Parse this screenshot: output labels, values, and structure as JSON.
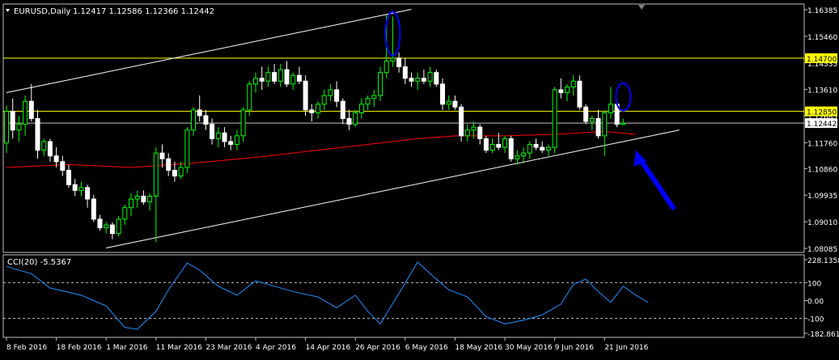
{
  "header": {
    "symbol": "EURUSD,Daily",
    "ohlc": "1.12417 1.12586 1.12366 1.12442"
  },
  "indicator": {
    "title": "CCI(20) -5.5367",
    "levels": [
      100,
      -100
    ],
    "y_ticks": [
      "228.1358",
      "100",
      "0.00",
      "-100",
      "-182.8614"
    ],
    "ylim": [
      -182.8614,
      228.1358
    ]
  },
  "colors": {
    "background": "#000000",
    "grid_border": "#c0c0c0",
    "bull_candle": "#00ff00",
    "bear_candle": "#ffffff",
    "ma_line": "#ff0000",
    "horizontal_level": "#ffff00",
    "channel_line": "#ffffff",
    "cci_line": "#1e90ff",
    "annotation": "#0000ff"
  },
  "chart_data": [
    {
      "type": "candlestick",
      "symbol": "EURUSD",
      "timeframe": "Daily",
      "ylim": [
        1.08085,
        1.16385
      ],
      "y_ticks": [
        "1.16385",
        "1.15460",
        "1.14535",
        "1.13610",
        "1.12685",
        "1.11760",
        "1.10860",
        "1.09935",
        "1.09010",
        "1.08085"
      ],
      "x_ticks": [
        "8 Feb 2016",
        "18 Feb 2016",
        "1 Mar 2016",
        "11 Mar 2016",
        "23 Mar 2016",
        "4 Apr 2016",
        "14 Apr 2016",
        "26 Apr 2016",
        "6 May 2016",
        "18 May 2016",
        "30 May 2016",
        "9 Jun 2016",
        "21 Jun 2016"
      ],
      "x_tick_index": [
        0,
        8,
        16,
        24,
        32,
        40,
        48,
        56,
        64,
        72,
        80,
        88,
        96
      ],
      "price_labels": [
        {
          "value": 1.147,
          "label": "1.14700",
          "style": "yellow-line"
        },
        {
          "value": 1.1285,
          "label": "1.12850",
          "style": "yellow-line"
        },
        {
          "value": 1.12442,
          "label": "1.12442",
          "style": "current-price"
        }
      ],
      "candles": [
        {
          "o": 1.1175,
          "h": 1.1305,
          "l": 1.114,
          "c": 1.1285
        },
        {
          "o": 1.1285,
          "h": 1.133,
          "l": 1.119,
          "c": 1.122
        },
        {
          "o": 1.122,
          "h": 1.127,
          "l": 1.118,
          "c": 1.124
        },
        {
          "o": 1.124,
          "h": 1.134,
          "l": 1.12,
          "c": 1.132
        },
        {
          "o": 1.132,
          "h": 1.138,
          "l": 1.125,
          "c": 1.126
        },
        {
          "o": 1.126,
          "h": 1.129,
          "l": 1.112,
          "c": 1.115
        },
        {
          "o": 1.115,
          "h": 1.119,
          "l": 1.113,
          "c": 1.118
        },
        {
          "o": 1.118,
          "h": 1.119,
          "l": 1.111,
          "c": 1.113
        },
        {
          "o": 1.113,
          "h": 1.116,
          "l": 1.109,
          "c": 1.111
        },
        {
          "o": 1.111,
          "h": 1.113,
          "l": 1.106,
          "c": 1.108
        },
        {
          "o": 1.108,
          "h": 1.11,
          "l": 1.102,
          "c": 1.103
        },
        {
          "o": 1.103,
          "h": 1.105,
          "l": 1.099,
          "c": 1.101
        },
        {
          "o": 1.101,
          "h": 1.104,
          "l": 1.099,
          "c": 1.102
        },
        {
          "o": 1.102,
          "h": 1.103,
          "l": 1.095,
          "c": 1.098
        },
        {
          "o": 1.098,
          "h": 1.0995,
          "l": 1.09,
          "c": 1.091
        },
        {
          "o": 1.091,
          "h": 1.0925,
          "l": 1.087,
          "c": 1.088
        },
        {
          "o": 1.088,
          "h": 1.09,
          "l": 1.086,
          "c": 1.089
        },
        {
          "o": 1.089,
          "h": 1.09,
          "l": 1.084,
          "c": 1.086
        },
        {
          "o": 1.086,
          "h": 1.092,
          "l": 1.085,
          "c": 1.091
        },
        {
          "o": 1.091,
          "h": 1.096,
          "l": 1.089,
          "c": 1.095
        },
        {
          "o": 1.095,
          "h": 1.1,
          "l": 1.092,
          "c": 1.098
        },
        {
          "o": 1.098,
          "h": 1.101,
          "l": 1.095,
          "c": 1.099
        },
        {
          "o": 1.099,
          "h": 1.101,
          "l": 1.096,
          "c": 1.097
        },
        {
          "o": 1.097,
          "h": 1.1,
          "l": 1.094,
          "c": 1.099
        },
        {
          "o": 1.099,
          "h": 1.116,
          "l": 1.083,
          "c": 1.114
        },
        {
          "o": 1.114,
          "h": 1.117,
          "l": 1.109,
          "c": 1.112
        },
        {
          "o": 1.112,
          "h": 1.114,
          "l": 1.106,
          "c": 1.108
        },
        {
          "o": 1.108,
          "h": 1.111,
          "l": 1.104,
          "c": 1.106
        },
        {
          "o": 1.106,
          "h": 1.111,
          "l": 1.105,
          "c": 1.109
        },
        {
          "o": 1.109,
          "h": 1.123,
          "l": 1.107,
          "c": 1.122
        },
        {
          "o": 1.122,
          "h": 1.13,
          "l": 1.12,
          "c": 1.129
        },
        {
          "o": 1.129,
          "h": 1.134,
          "l": 1.125,
          "c": 1.127
        },
        {
          "o": 1.127,
          "h": 1.129,
          "l": 1.122,
          "c": 1.124
        },
        {
          "o": 1.124,
          "h": 1.126,
          "l": 1.117,
          "c": 1.119
        },
        {
          "o": 1.119,
          "h": 1.123,
          "l": 1.116,
          "c": 1.121
        },
        {
          "o": 1.121,
          "h": 1.123,
          "l": 1.116,
          "c": 1.118
        },
        {
          "o": 1.118,
          "h": 1.12,
          "l": 1.115,
          "c": 1.117
        },
        {
          "o": 1.117,
          "h": 1.122,
          "l": 1.115,
          "c": 1.12
        },
        {
          "o": 1.12,
          "h": 1.13,
          "l": 1.118,
          "c": 1.129
        },
        {
          "o": 1.129,
          "h": 1.139,
          "l": 1.127,
          "c": 1.138
        },
        {
          "o": 1.138,
          "h": 1.142,
          "l": 1.135,
          "c": 1.14
        },
        {
          "o": 1.14,
          "h": 1.144,
          "l": 1.136,
          "c": 1.139
        },
        {
          "o": 1.139,
          "h": 1.144,
          "l": 1.137,
          "c": 1.142
        },
        {
          "o": 1.142,
          "h": 1.145,
          "l": 1.138,
          "c": 1.139
        },
        {
          "o": 1.139,
          "h": 1.145,
          "l": 1.137,
          "c": 1.143
        },
        {
          "o": 1.143,
          "h": 1.146,
          "l": 1.137,
          "c": 1.138
        },
        {
          "o": 1.138,
          "h": 1.142,
          "l": 1.136,
          "c": 1.141
        },
        {
          "o": 1.141,
          "h": 1.144,
          "l": 1.138,
          "c": 1.139
        },
        {
          "o": 1.139,
          "h": 1.141,
          "l": 1.127,
          "c": 1.129
        },
        {
          "o": 1.129,
          "h": 1.131,
          "l": 1.125,
          "c": 1.128
        },
        {
          "o": 1.128,
          "h": 1.132,
          "l": 1.126,
          "c": 1.131
        },
        {
          "o": 1.131,
          "h": 1.136,
          "l": 1.129,
          "c": 1.134
        },
        {
          "o": 1.134,
          "h": 1.138,
          "l": 1.132,
          "c": 1.136
        },
        {
          "o": 1.136,
          "h": 1.139,
          "l": 1.13,
          "c": 1.132
        },
        {
          "o": 1.132,
          "h": 1.133,
          "l": 1.124,
          "c": 1.126
        },
        {
          "o": 1.126,
          "h": 1.129,
          "l": 1.122,
          "c": 1.124
        },
        {
          "o": 1.124,
          "h": 1.129,
          "l": 1.123,
          "c": 1.128
        },
        {
          "o": 1.128,
          "h": 1.133,
          "l": 1.126,
          "c": 1.131
        },
        {
          "o": 1.131,
          "h": 1.134,
          "l": 1.129,
          "c": 1.133
        },
        {
          "o": 1.133,
          "h": 1.136,
          "l": 1.13,
          "c": 1.134
        },
        {
          "o": 1.134,
          "h": 1.144,
          "l": 1.132,
          "c": 1.142
        },
        {
          "o": 1.142,
          "h": 1.162,
          "l": 1.14,
          "c": 1.146
        },
        {
          "o": 1.146,
          "h": 1.1615,
          "l": 1.144,
          "c": 1.147
        },
        {
          "o": 1.147,
          "h": 1.149,
          "l": 1.142,
          "c": 1.144
        },
        {
          "o": 1.144,
          "h": 1.147,
          "l": 1.138,
          "c": 1.14
        },
        {
          "o": 1.14,
          "h": 1.142,
          "l": 1.137,
          "c": 1.139
        },
        {
          "o": 1.139,
          "h": 1.142,
          "l": 1.136,
          "c": 1.14
        },
        {
          "o": 1.14,
          "h": 1.143,
          "l": 1.138,
          "c": 1.139
        },
        {
          "o": 1.139,
          "h": 1.144,
          "l": 1.137,
          "c": 1.142
        },
        {
          "o": 1.142,
          "h": 1.143,
          "l": 1.137,
          "c": 1.138
        },
        {
          "o": 1.138,
          "h": 1.14,
          "l": 1.129,
          "c": 1.131
        },
        {
          "o": 1.131,
          "h": 1.134,
          "l": 1.129,
          "c": 1.132
        },
        {
          "o": 1.132,
          "h": 1.134,
          "l": 1.129,
          "c": 1.13
        },
        {
          "o": 1.13,
          "h": 1.131,
          "l": 1.118,
          "c": 1.12
        },
        {
          "o": 1.12,
          "h": 1.124,
          "l": 1.118,
          "c": 1.122
        },
        {
          "o": 1.122,
          "h": 1.125,
          "l": 1.119,
          "c": 1.123
        },
        {
          "o": 1.123,
          "h": 1.124,
          "l": 1.117,
          "c": 1.119
        },
        {
          "o": 1.119,
          "h": 1.12,
          "l": 1.114,
          "c": 1.115
        },
        {
          "o": 1.115,
          "h": 1.119,
          "l": 1.114,
          "c": 1.117
        },
        {
          "o": 1.117,
          "h": 1.121,
          "l": 1.115,
          "c": 1.116
        },
        {
          "o": 1.116,
          "h": 1.12,
          "l": 1.114,
          "c": 1.119
        },
        {
          "o": 1.119,
          "h": 1.12,
          "l": 1.111,
          "c": 1.112
        },
        {
          "o": 1.112,
          "h": 1.115,
          "l": 1.11,
          "c": 1.113
        },
        {
          "o": 1.113,
          "h": 1.116,
          "l": 1.111,
          "c": 1.114
        },
        {
          "o": 1.114,
          "h": 1.118,
          "l": 1.112,
          "c": 1.117
        },
        {
          "o": 1.117,
          "h": 1.119,
          "l": 1.115,
          "c": 1.116
        },
        {
          "o": 1.116,
          "h": 1.118,
          "l": 1.114,
          "c": 1.115
        },
        {
          "o": 1.115,
          "h": 1.117,
          "l": 1.113,
          "c": 1.116
        },
        {
          "o": 1.116,
          "h": 1.137,
          "l": 1.114,
          "c": 1.136
        },
        {
          "o": 1.136,
          "h": 1.14,
          "l": 1.133,
          "c": 1.135
        },
        {
          "o": 1.135,
          "h": 1.138,
          "l": 1.132,
          "c": 1.137
        },
        {
          "o": 1.137,
          "h": 1.141,
          "l": 1.134,
          "c": 1.139
        },
        {
          "o": 1.139,
          "h": 1.141,
          "l": 1.129,
          "c": 1.13
        },
        {
          "o": 1.13,
          "h": 1.131,
          "l": 1.124,
          "c": 1.125
        },
        {
          "o": 1.125,
          "h": 1.127,
          "l": 1.122,
          "c": 1.126
        },
        {
          "o": 1.126,
          "h": 1.129,
          "l": 1.119,
          "c": 1.12
        },
        {
          "o": 1.12,
          "h": 1.129,
          "l": 1.113,
          "c": 1.128
        },
        {
          "o": 1.128,
          "h": 1.137,
          "l": 1.126,
          "c": 1.131
        },
        {
          "o": 1.131,
          "h": 1.132,
          "l": 1.123,
          "c": 1.124
        },
        {
          "o": 1.124,
          "h": 1.1259,
          "l": 1.1237,
          "c": 1.1244
        }
      ],
      "ma": [
        [
          0,
          1.109
        ],
        [
          10,
          1.11
        ],
        [
          20,
          1.109
        ],
        [
          30,
          1.1105
        ],
        [
          40,
          1.1125
        ],
        [
          50,
          1.115
        ],
        [
          60,
          1.1175
        ],
        [
          66,
          1.119
        ],
        [
          72,
          1.12
        ],
        [
          80,
          1.12
        ],
        [
          88,
          1.1205
        ],
        [
          96,
          1.1215
        ],
        [
          101,
          1.1205
        ]
      ],
      "horizontal_lines": [
        1.147,
        1.1285,
        1.12442
      ],
      "channel_lines": [
        {
          "from": [
            0,
            1.135
          ],
          "to": [
            65,
            1.164
          ]
        },
        {
          "from": [
            16,
            1.081
          ],
          "to": [
            108,
            1.122
          ]
        }
      ],
      "annotations": [
        {
          "type": "ellipse",
          "index": 62,
          "y": 1.1555
        },
        {
          "type": "ellipse",
          "index": 99,
          "y": 1.1335
        },
        {
          "type": "arrow",
          "direction": "up-left",
          "from": [
            107,
            1.095
          ],
          "to": [
            101,
            1.115
          ]
        }
      ]
    },
    {
      "type": "line",
      "name": "CCI(20)",
      "ylim": [
        -182.8614,
        228.1358
      ],
      "anchors": [
        [
          0,
          190
        ],
        [
          4,
          150
        ],
        [
          7,
          70
        ],
        [
          12,
          30
        ],
        [
          16,
          -30
        ],
        [
          19,
          -150
        ],
        [
          21,
          -160
        ],
        [
          24,
          -60
        ],
        [
          26,
          60
        ],
        [
          29,
          210
        ],
        [
          31,
          170
        ],
        [
          34,
          80
        ],
        [
          37,
          30
        ],
        [
          40,
          110
        ],
        [
          43,
          80
        ],
        [
          46,
          50
        ],
        [
          50,
          20
        ],
        [
          53,
          -40
        ],
        [
          56,
          30
        ],
        [
          58,
          -60
        ],
        [
          60,
          -130
        ],
        [
          63,
          40
        ],
        [
          66,
          215
        ],
        [
          68,
          150
        ],
        [
          71,
          60
        ],
        [
          74,
          20
        ],
        [
          77,
          -90
        ],
        [
          80,
          -130
        ],
        [
          83,
          -110
        ],
        [
          86,
          -80
        ],
        [
          89,
          -20
        ],
        [
          91,
          90
        ],
        [
          93,
          120
        ],
        [
          95,
          50
        ],
        [
          97,
          -10
        ],
        [
          99,
          80
        ],
        [
          101,
          30
        ],
        [
          103,
          -10
        ]
      ]
    }
  ]
}
